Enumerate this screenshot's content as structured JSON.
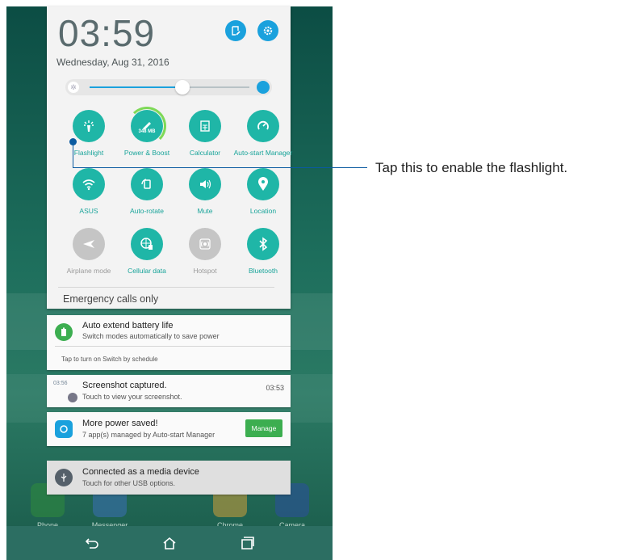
{
  "panel": {
    "time": "03:59",
    "date": "Wednesday, Aug 31, 2016",
    "brightness_level": 0.58,
    "emergency": "Emergency calls only"
  },
  "quick_settings": [
    {
      "label": "Flashlight",
      "icon": "flashlight-icon",
      "on": true
    },
    {
      "label": "Power & Boost",
      "icon": "boost-icon",
      "on": true,
      "badge": "348 MB"
    },
    {
      "label": "Calculator",
      "icon": "calculator-icon",
      "on": true
    },
    {
      "label": "Auto-start Manager",
      "icon": "autostart-icon",
      "on": true
    },
    {
      "label": "ASUS",
      "icon": "wifi-icon",
      "on": true
    },
    {
      "label": "Auto-rotate",
      "icon": "rotate-icon",
      "on": true
    },
    {
      "label": "Mute",
      "icon": "mute-icon",
      "on": true
    },
    {
      "label": "Location",
      "icon": "location-icon",
      "on": true
    },
    {
      "label": "Airplane mode",
      "icon": "airplane-icon",
      "on": false
    },
    {
      "label": "Cellular data",
      "icon": "cellular-icon",
      "on": true
    },
    {
      "label": "Hotspot",
      "icon": "hotspot-icon",
      "on": false
    },
    {
      "label": "Bluetooth",
      "icon": "bluetooth-icon",
      "on": true
    }
  ],
  "notifications": {
    "battery": {
      "title": "Auto extend battery life",
      "subtitle": "Switch modes automatically to save power",
      "action": "Tap to turn on Switch by schedule"
    },
    "screenshot": {
      "title": "Screenshot captured.",
      "subtitle": "Touch to view your screenshot.",
      "time": "03:53",
      "thumb": "03:56"
    },
    "power": {
      "title": "More power saved!",
      "subtitle": "7 app(s) managed by Auto-start Manager",
      "button": "Manage"
    },
    "usb": {
      "title": "Connected as a media device",
      "subtitle": "Touch for other USB options."
    }
  },
  "dock": [
    "Phone",
    "Messenger",
    "Chrome",
    "Camera"
  ],
  "annotation": "Tap this to enable the flashlight.",
  "colors": {
    "accent": "#1aa1dd",
    "tile_on": "#1fb6a7",
    "tile_off": "#c5c5c5",
    "manage": "#3cae50",
    "annotation": "#0a5aa0"
  }
}
